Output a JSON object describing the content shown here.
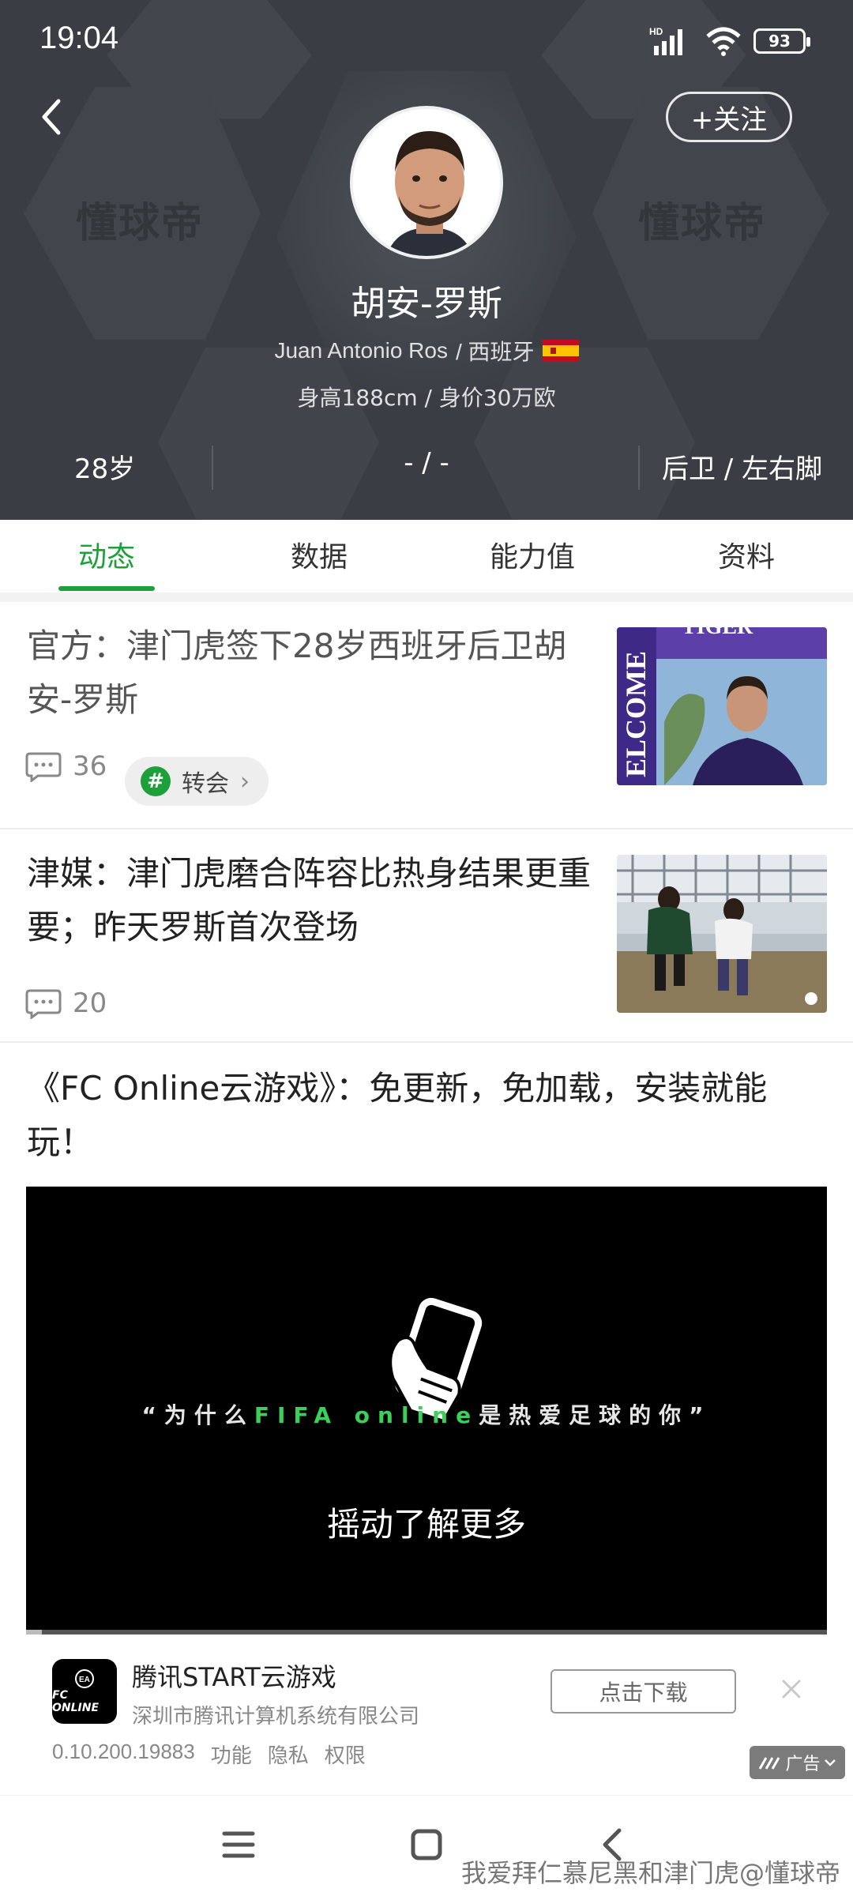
{
  "status_bar": {
    "time": "19:04",
    "network": "HD",
    "battery": "93"
  },
  "header": {
    "watermark": "懂球帝",
    "follow_label": "+关注",
    "player_name": "胡安-罗斯",
    "english_name": "Juan Antonio Ros",
    "nationality": "/ 西班牙",
    "height_value": "身高188cm / 身价30万欧",
    "stats": {
      "age": "28岁",
      "club_number": "- / -",
      "position": "后卫 / 左右脚"
    }
  },
  "tabs": [
    {
      "label": "动态",
      "active": true
    },
    {
      "label": "数据",
      "active": false
    },
    {
      "label": "能力值",
      "active": false
    },
    {
      "label": "资料",
      "active": false
    }
  ],
  "news": [
    {
      "title": "官方：津门虎签下28岁西班牙后卫胡安-罗斯",
      "comments": "36",
      "tag": "转会",
      "thumb_text_top": "TIGER",
      "thumb_text_side": "ELCOME"
    },
    {
      "title": "津媒：津门虎磨合阵容比热身结果更重要；昨天罗斯首次登场",
      "comments": "20"
    }
  ],
  "ad": {
    "title": "《FC Online云游戏》：免更新，免加载，安装就能玩！",
    "quote_pre": "“为什么",
    "quote_green": "FIFA online",
    "quote_post": "是热爱足球的你”",
    "shake_text": "摇动了解更多",
    "app_name": "腾讯START云游戏",
    "company": "深圳市腾讯计算机系统有限公司",
    "version": "0.10.200.19883",
    "links": [
      "功能",
      "隐私",
      "权限"
    ],
    "download_label": "点击下载",
    "ad_badge": "广告",
    "logo_text": "FC ONLINE"
  },
  "credit": "我爱拜仁慕尼黑和津门虎@懂球帝",
  "colors": {
    "accent": "#1d9f3a",
    "header_bg": "#3a3e44"
  }
}
